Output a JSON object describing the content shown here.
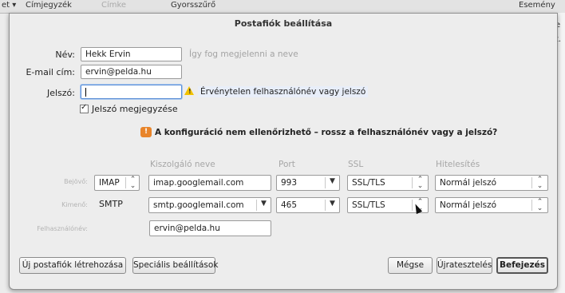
{
  "background": {
    "tabs": [
      "Címjegyzék",
      "Címke",
      "Gyorsszűrő"
    ],
    "right_label": "Esemény",
    "right_chars": [
      "e",
      "t."
    ]
  },
  "dialog": {
    "title": "Postafiók beállítása",
    "name": {
      "label": "Név:",
      "value": "Hekk Ervin",
      "hint": "Így fog megjelenni a neve"
    },
    "email": {
      "label": "E-mail cím:",
      "value": "ervin@pelda.hu"
    },
    "password": {
      "label": "Jelszó:",
      "value": "",
      "error": "Érvénytelen felhasználónév vagy jelszó"
    },
    "remember": {
      "label": "Jelszó megjegyzése",
      "checked": true
    },
    "alert": "A konfiguráció nem ellenőrizhető – rossz a felhasználónév vagy a jelszó?",
    "columns": {
      "server": "Kiszolgáló neve",
      "port": "Port",
      "ssl": "SSL",
      "auth": "Hitelesítés"
    },
    "incoming": {
      "label": "Bejövő:",
      "protocol": "IMAP",
      "server": "imap.googlemail.com",
      "port": "993",
      "ssl": "SSL/TLS",
      "auth": "Normál jelszó"
    },
    "outgoing": {
      "label": "Kimenő:",
      "protocol": "SMTP",
      "server": "smtp.googlemail.com",
      "port": "465",
      "ssl": "SSL/TLS",
      "auth": "Normál jelszó"
    },
    "username": {
      "label": "Felhasználónév:",
      "value": "ervin@pelda.hu"
    },
    "buttons": {
      "new_account": "Új postafiók létrehozása",
      "advanced": "Speciális beállítások",
      "cancel": "Mégse",
      "retest": "Újratesztelés",
      "finish": "Befejezés"
    }
  }
}
